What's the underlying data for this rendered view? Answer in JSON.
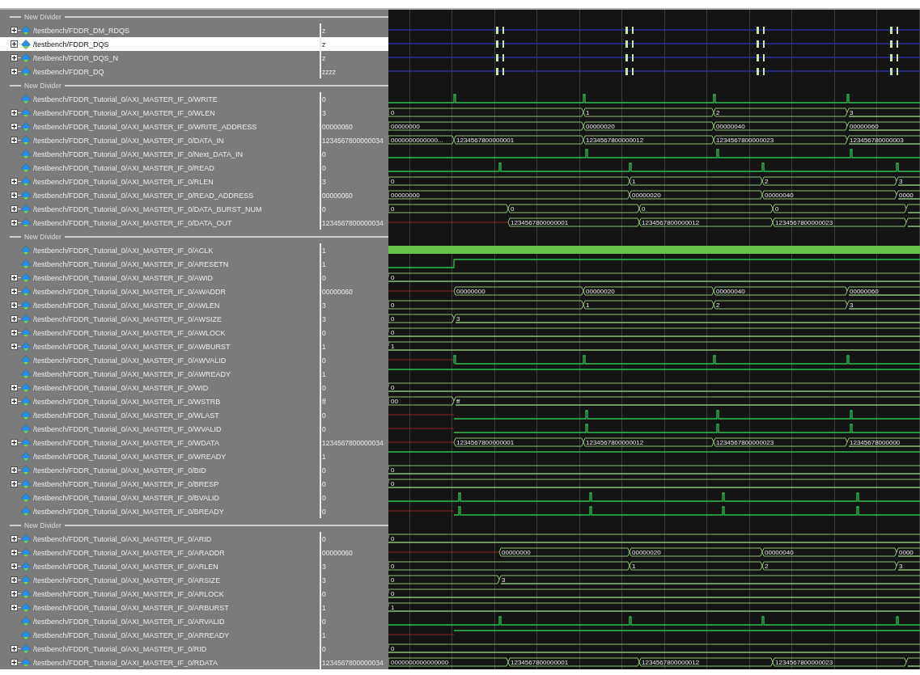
{
  "rows": [
    {
      "kind": "divider",
      "label": "New Divider"
    },
    {
      "kind": "signal",
      "name": "/testbench/FDDR_DM_RDQS",
      "value": "z",
      "expandable": true,
      "selected": false,
      "wave": {
        "kind": "z"
      }
    },
    {
      "kind": "signal",
      "name": "/testbench/FDDR_DQS",
      "value": "z",
      "expandable": true,
      "selected": true,
      "wave": {
        "kind": "z"
      }
    },
    {
      "kind": "signal",
      "name": "/testbench/FDDR_DQS_N",
      "value": "z",
      "expandable": true,
      "selected": false,
      "wave": {
        "kind": "z"
      }
    },
    {
      "kind": "signal",
      "name": "/testbench/FDDR_DQ",
      "value": "zzzz",
      "expandable": true,
      "selected": false,
      "wave": {
        "kind": "z"
      }
    },
    {
      "kind": "divider",
      "label": "New Divider"
    },
    {
      "kind": "signal",
      "name": "/testbench/FDDR_Tutorial_0/AXI_MASTER_IF_0/WRITE",
      "value": "0",
      "expandable": false,
      "selected": false,
      "wave": {
        "kind": "wpulse"
      }
    },
    {
      "kind": "signal",
      "name": "/testbench/FDDR_Tutorial_0/AXI_MASTER_IF_0/WLEN",
      "value": "3",
      "expandable": true,
      "selected": false,
      "wave": {
        "kind": "wbus",
        "segments": [
          "0",
          "1",
          "2",
          "3"
        ]
      }
    },
    {
      "kind": "signal",
      "name": "/testbench/FDDR_Tutorial_0/AXI_MASTER_IF_0/WRITE_ADDRESS",
      "value": "00000060",
      "expandable": true,
      "selected": false,
      "wave": {
        "kind": "wbus",
        "segments": [
          "00000000",
          "00000020",
          "00000040",
          "00000060"
        ]
      }
    },
    {
      "kind": "signal",
      "name": "/testbench/FDDR_Tutorial_0/AXI_MASTER_IF_0/DATA_IN",
      "value": "1234567800000034",
      "expandable": true,
      "selected": false,
      "wave": {
        "kind": "wdata",
        "segments": [
          "0000000000000...",
          "1234567800000001",
          "1234567800000012",
          "1234567800000023",
          "123456780000003"
        ]
      }
    },
    {
      "kind": "signal",
      "name": "/testbench/FDDR_Tutorial_0/AXI_MASTER_IF_0/Next_DATA_IN",
      "value": "0",
      "expandable": false,
      "selected": false,
      "wave": {
        "kind": "wpulselate"
      }
    },
    {
      "kind": "signal",
      "name": "/testbench/FDDR_Tutorial_0/AXI_MASTER_IF_0/READ",
      "value": "0",
      "expandable": false,
      "selected": false,
      "wave": {
        "kind": "rpulse"
      }
    },
    {
      "kind": "signal",
      "name": "/testbench/FDDR_Tutorial_0/AXI_MASTER_IF_0/RLEN",
      "value": "3",
      "expandable": true,
      "selected": false,
      "wave": {
        "kind": "rbus",
        "segments": [
          "0",
          "1",
          "2",
          "3"
        ]
      }
    },
    {
      "kind": "signal",
      "name": "/testbench/FDDR_Tutorial_0/AXI_MASTER_IF_0/READ_ADDRESS",
      "value": "00000060",
      "expandable": true,
      "selected": false,
      "wave": {
        "kind": "rbus",
        "segments": [
          "00000000",
          "00000020",
          "00000040",
          "0000"
        ]
      }
    },
    {
      "kind": "signal",
      "name": "/testbench/FDDR_Tutorial_0/AXI_MASTER_IF_0/DATA_BURST_NUM",
      "value": "0",
      "expandable": true,
      "selected": false,
      "wave": {
        "kind": "obus",
        "segments": [
          "0",
          "0",
          "0",
          "0"
        ]
      }
    },
    {
      "kind": "signal",
      "name": "/testbench/FDDR_Tutorial_0/AXI_MASTER_IF_0/DATA_OUT",
      "value": "1234567800000034",
      "expandable": true,
      "selected": false,
      "wave": {
        "kind": "oxbus",
        "segments": [
          "1234567800000001",
          "1234567800000012",
          "1234567800000023"
        ]
      }
    },
    {
      "kind": "divider",
      "label": "New Divider"
    },
    {
      "kind": "signal",
      "name": "/testbench/FDDR_Tutorial_0/AXI_MASTER_IF_0/ACLK",
      "value": "1",
      "expandable": false,
      "selected": false,
      "wave": {
        "kind": "clock"
      }
    },
    {
      "kind": "signal",
      "name": "/testbench/FDDR_Tutorial_0/AXI_MASTER_IF_0/ARESETN",
      "value": "1",
      "expandable": false,
      "selected": false,
      "wave": {
        "kind": "reset"
      }
    },
    {
      "kind": "signal",
      "name": "/testbench/FDDR_Tutorial_0/AXI_MASTER_IF_0/AWID",
      "value": "0",
      "expandable": true,
      "selected": false,
      "wave": {
        "kind": "constbus",
        "segments": [
          "0"
        ]
      }
    },
    {
      "kind": "signal",
      "name": "/testbench/FDDR_Tutorial_0/AXI_MASTER_IF_0/AWADDR",
      "value": "00000060",
      "expandable": true,
      "selected": false,
      "wave": {
        "kind": "wxbus",
        "segments": [
          "00000000",
          "00000020",
          "00000040",
          "00000060"
        ]
      }
    },
    {
      "kind": "signal",
      "name": "/testbench/FDDR_Tutorial_0/AXI_MASTER_IF_0/AWLEN",
      "value": "3",
      "expandable": true,
      "selected": false,
      "wave": {
        "kind": "wbus",
        "segments": [
          "0",
          "1",
          "2",
          "3"
        ]
      }
    },
    {
      "kind": "signal",
      "name": "/testbench/FDDR_Tutorial_0/AXI_MASTER_IF_0/AWSIZE",
      "value": "3",
      "expandable": true,
      "selected": false,
      "wave": {
        "kind": "wonce",
        "segments": [
          "0",
          "3"
        ]
      }
    },
    {
      "kind": "signal",
      "name": "/testbench/FDDR_Tutorial_0/AXI_MASTER_IF_0/AWLOCK",
      "value": "0",
      "expandable": true,
      "selected": false,
      "wave": {
        "kind": "constbus",
        "segments": [
          "0"
        ]
      }
    },
    {
      "kind": "signal",
      "name": "/testbench/FDDR_Tutorial_0/AXI_MASTER_IF_0/AWBURST",
      "value": "1",
      "expandable": true,
      "selected": false,
      "wave": {
        "kind": "constbus",
        "segments": [
          "1"
        ]
      }
    },
    {
      "kind": "signal",
      "name": "/testbench/FDDR_Tutorial_0/AXI_MASTER_IF_0/AWVALID",
      "value": "0",
      "expandable": false,
      "selected": false,
      "wave": {
        "kind": "wxpulse"
      }
    },
    {
      "kind": "signal",
      "name": "/testbench/FDDR_Tutorial_0/AXI_MASTER_IF_0/AWREADY",
      "value": "1",
      "expandable": false,
      "selected": false,
      "wave": {
        "kind": "high"
      }
    },
    {
      "kind": "signal",
      "name": "/testbench/FDDR_Tutorial_0/AXI_MASTER_IF_0/WID",
      "value": "0",
      "expandable": true,
      "selected": false,
      "wave": {
        "kind": "constbus",
        "segments": [
          "0"
        ]
      }
    },
    {
      "kind": "signal",
      "name": "/testbench/FDDR_Tutorial_0/AXI_MASTER_IF_0/WSTRB",
      "value": "ff",
      "expandable": true,
      "selected": false,
      "wave": {
        "kind": "wonce",
        "segments": [
          "00",
          "ff"
        ]
      }
    },
    {
      "kind": "signal",
      "name": "/testbench/FDDR_Tutorial_0/AXI_MASTER_IF_0/WLAST",
      "value": "0",
      "expandable": false,
      "selected": false,
      "wave": {
        "kind": "wxpulselate"
      }
    },
    {
      "kind": "signal",
      "name": "/testbench/FDDR_Tutorial_0/AXI_MASTER_IF_0/WVALID",
      "value": "0",
      "expandable": false,
      "selected": false,
      "wave": {
        "kind": "wxpulselate"
      }
    },
    {
      "kind": "signal",
      "name": "/testbench/FDDR_Tutorial_0/AXI_MASTER_IF_0/WDATA",
      "value": "1234567800000034",
      "expandable": true,
      "selected": false,
      "wave": {
        "kind": "wxbus",
        "segments": [
          "1234567800000001",
          "1234567800000012",
          "1234567800000023",
          "12345678000000"
        ]
      }
    },
    {
      "kind": "signal",
      "name": "/testbench/FDDR_Tutorial_0/AXI_MASTER_IF_0/WREADY",
      "value": "1",
      "expandable": false,
      "selected": false,
      "wave": {
        "kind": "high"
      }
    },
    {
      "kind": "signal",
      "name": "/testbench/FDDR_Tutorial_0/AXI_MASTER_IF_0/BID",
      "value": "0",
      "expandable": true,
      "selected": false,
      "wave": {
        "kind": "constbus",
        "segments": [
          "0"
        ]
      }
    },
    {
      "kind": "signal",
      "name": "/testbench/FDDR_Tutorial_0/AXI_MASTER_IF_0/BRESP",
      "value": "0",
      "expandable": true,
      "selected": false,
      "wave": {
        "kind": "constbus",
        "segments": [
          "0"
        ]
      }
    },
    {
      "kind": "signal",
      "name": "/testbench/FDDR_Tutorial_0/AXI_MASTER_IF_0/BVALID",
      "value": "0",
      "expandable": false,
      "selected": false,
      "wave": {
        "kind": "bpulse"
      }
    },
    {
      "kind": "signal",
      "name": "/testbench/FDDR_Tutorial_0/AXI_MASTER_IF_0/BREADY",
      "value": "0",
      "expandable": false,
      "selected": false,
      "wave": {
        "kind": "bxpulse"
      }
    },
    {
      "kind": "divider",
      "label": "New Divider"
    },
    {
      "kind": "signal",
      "name": "/testbench/FDDR_Tutorial_0/AXI_MASTER_IF_0/ARID",
      "value": "0",
      "expandable": true,
      "selected": false,
      "wave": {
        "kind": "constbus",
        "segments": [
          "0"
        ]
      }
    },
    {
      "kind": "signal",
      "name": "/testbench/FDDR_Tutorial_0/AXI_MASTER_IF_0/ARADDR",
      "value": "00000060",
      "expandable": true,
      "selected": false,
      "wave": {
        "kind": "rxbus",
        "segments": [
          "00000000",
          "00000020",
          "00000040",
          "0000"
        ]
      }
    },
    {
      "kind": "signal",
      "name": "/testbench/FDDR_Tutorial_0/AXI_MASTER_IF_0/ARLEN",
      "value": "3",
      "expandable": true,
      "selected": false,
      "wave": {
        "kind": "rbus",
        "segments": [
          "0",
          "1",
          "2",
          "3"
        ]
      }
    },
    {
      "kind": "signal",
      "name": "/testbench/FDDR_Tutorial_0/AXI_MASTER_IF_0/ARSIZE",
      "value": "3",
      "expandable": true,
      "selected": false,
      "wave": {
        "kind": "ronce",
        "segments": [
          "0",
          "3"
        ]
      }
    },
    {
      "kind": "signal",
      "name": "/testbench/FDDR_Tutorial_0/AXI_MASTER_IF_0/ARLOCK",
      "value": "0",
      "expandable": true,
      "selected": false,
      "wave": {
        "kind": "constbus",
        "segments": [
          "0"
        ]
      }
    },
    {
      "kind": "signal",
      "name": "/testbench/FDDR_Tutorial_0/AXI_MASTER_IF_0/ARBURST",
      "value": "1",
      "expandable": true,
      "selected": false,
      "wave": {
        "kind": "constbus",
        "segments": [
          "1"
        ]
      }
    },
    {
      "kind": "signal",
      "name": "/testbench/FDDR_Tutorial_0/AXI_MASTER_IF_0/ARVALID",
      "value": "0",
      "expandable": false,
      "selected": false,
      "wave": {
        "kind": "rpulse"
      }
    },
    {
      "kind": "signal",
      "name": "/testbench/FDDR_Tutorial_0/AXI_MASTER_IF_0/ARREADY",
      "value": "1",
      "expandable": false,
      "selected": false,
      "wave": {
        "kind": "xhigh"
      }
    },
    {
      "kind": "signal",
      "name": "/testbench/FDDR_Tutorial_0/AXI_MASTER_IF_0/RID",
      "value": "0",
      "expandable": true,
      "selected": false,
      "wave": {
        "kind": "constbus",
        "segments": [
          "0"
        ]
      }
    },
    {
      "kind": "signal",
      "name": "/testbench/FDDR_Tutorial_0/AXI_MASTER_IF_0/RDATA",
      "value": "1234567800000034",
      "expandable": true,
      "selected": false,
      "wave": {
        "kind": "obus",
        "segments": [
          "0000000000000000",
          "1234567800000001",
          "1234567800000012",
          "1234567800000023"
        ]
      }
    }
  ]
}
